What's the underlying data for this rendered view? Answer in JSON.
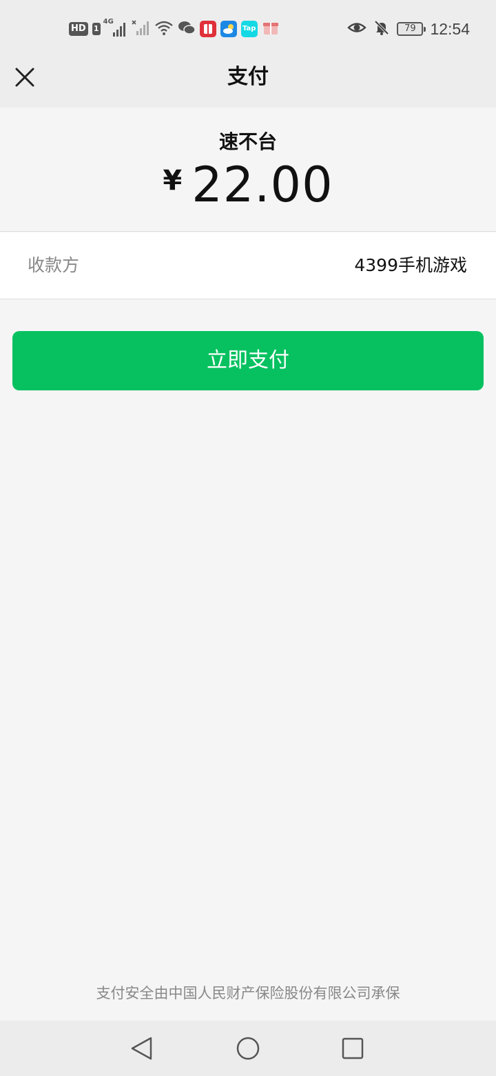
{
  "status_bar": {
    "network_badge": "HD",
    "sim_badge": "1",
    "signal_type": "4G",
    "battery_level": "79",
    "time": "12:54",
    "icons": [
      "hd-icon",
      "signal-4g-icon",
      "signal-no-sim-icon",
      "wifi-icon",
      "wechat-icon",
      "app-red-icon",
      "weather-icon",
      "taptap-icon",
      "gift-box-icon",
      "eye-icon",
      "mute-bell-icon",
      "battery-icon"
    ],
    "taptap_label": "Tap"
  },
  "header": {
    "title": "支付"
  },
  "payment": {
    "merchant": "速不台",
    "currency_symbol": "¥",
    "amount": "22.00"
  },
  "payee": {
    "label": "收款方",
    "value": "4399手机游戏"
  },
  "pay_button": {
    "label": "立即支付",
    "color": "#07c160"
  },
  "footer": {
    "text": "支付安全由中国人民财产保险股份有限公司承保"
  },
  "nav_bar": {
    "icons": [
      "back-icon",
      "home-icon",
      "recents-icon"
    ]
  }
}
